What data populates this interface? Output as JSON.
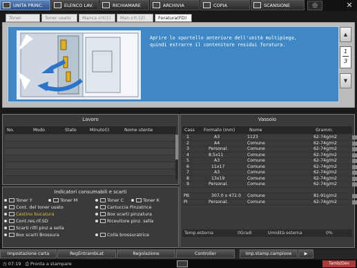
{
  "topnav": {
    "items": [
      {
        "label": "UNITA PRINC.",
        "icon": "home-icon"
      },
      {
        "label": "ELENCO LAV.",
        "icon": "joblist-icon"
      },
      {
        "label": "RICHIAMARE",
        "icon": "recall-icon"
      },
      {
        "label": "ARCHIVIA",
        "icon": "archive-icon"
      },
      {
        "label": "COPIA",
        "icon": "copy-icon"
      },
      {
        "label": "SCANSIONE",
        "icon": "scan-icon"
      }
    ],
    "close_icon": "close-icon"
  },
  "tabs": [
    {
      "label": "Toner",
      "active": false
    },
    {
      "label": "Toner usato",
      "active": false
    },
    {
      "label": "Manca crt(1)",
      "active": false
    },
    {
      "label": "Man.crt.(2)",
      "active": false
    },
    {
      "label": "Foratura(FD)",
      "active": true
    }
  ],
  "instruction": {
    "line1": "Aprire lo sportello anteriore dell'unità multipiega,",
    "line2": "quindi estrarre il contenitore residui foratura."
  },
  "pager": {
    "current": "1",
    "total": "3"
  },
  "lavoro": {
    "title": "Lavoro",
    "columns": [
      "No.",
      "Modo",
      "Stato",
      "Minuto(i)",
      "Nome utente"
    ]
  },
  "consumabili": {
    "title": "Indicatori consumabili e scarti",
    "items": [
      "Toner Y",
      "Toner M",
      "Toner C",
      "Toner K",
      "Cont. del toner usato",
      "Cartuccia Pinzatrice",
      "Cestino bucatura",
      "Box scarti pinzatura",
      "Cont.res.rif.SD",
      "Ricevitore pinz. sella",
      "Scarti rifil pinz a sella",
      "Box scarti Brossura",
      "Colla brossuratrice"
    ]
  },
  "vassoio": {
    "title": "Vassoio",
    "columns": [
      "Cass",
      "Formato (mm)",
      "Nome",
      "Gramm."
    ],
    "rows": [
      {
        "cass": "1",
        "formato": "A3",
        "nome": "1123",
        "gramm": "62-74g/m2"
      },
      {
        "cass": "2",
        "formato": "A4",
        "nome": "Comune",
        "gramm": "62-74g/m2"
      },
      {
        "cass": "3",
        "formato": "Personal.",
        "nome": "Comune",
        "gramm": "62-74g/m2"
      },
      {
        "cass": "4",
        "formato": "8.5x11",
        "nome": "Comune",
        "gramm": "62-74g/m2"
      },
      {
        "cass": "5",
        "formato": "A3",
        "nome": "Comune",
        "gramm": "62-74g/m2"
      },
      {
        "cass": "6",
        "formato": "11x17",
        "nome": "Comune",
        "gramm": "62-74g/m2"
      },
      {
        "cass": "7",
        "formato": "A3",
        "nome": "Comune",
        "gramm": "62-74g/m2"
      },
      {
        "cass": "8",
        "formato": "13x19",
        "nome": "Comune",
        "gramm": "62-74g/m2"
      },
      {
        "cass": "9",
        "formato": "Personal.",
        "nome": "Comune",
        "gramm": "62-74g/m2"
      },
      {
        "cass": "",
        "formato": "",
        "nome": "",
        "gramm": ""
      },
      {
        "cass": "PB",
        "formato": "307.0 x 472.0",
        "nome": "Comune",
        "gramm": "81-91g/m2"
      },
      {
        "cass": "PI",
        "formato": "Personal.",
        "nome": "Comune",
        "gramm": "62-74g/m2"
      }
    ],
    "temp_label": "Temp.esterna",
    "temp_value": "0Gradi",
    "umidita_label": "Umidità esterna",
    "umidita_value": "0%"
  },
  "bottom": {
    "buttons": [
      "Impostazione carta",
      "RegEntrambLat",
      "Regolazione",
      "Controller",
      "Imp.stamp.campione"
    ]
  },
  "status": {
    "time": "07:19",
    "state": "Pronta a stampare",
    "flag": "Tamb/Dev"
  }
}
